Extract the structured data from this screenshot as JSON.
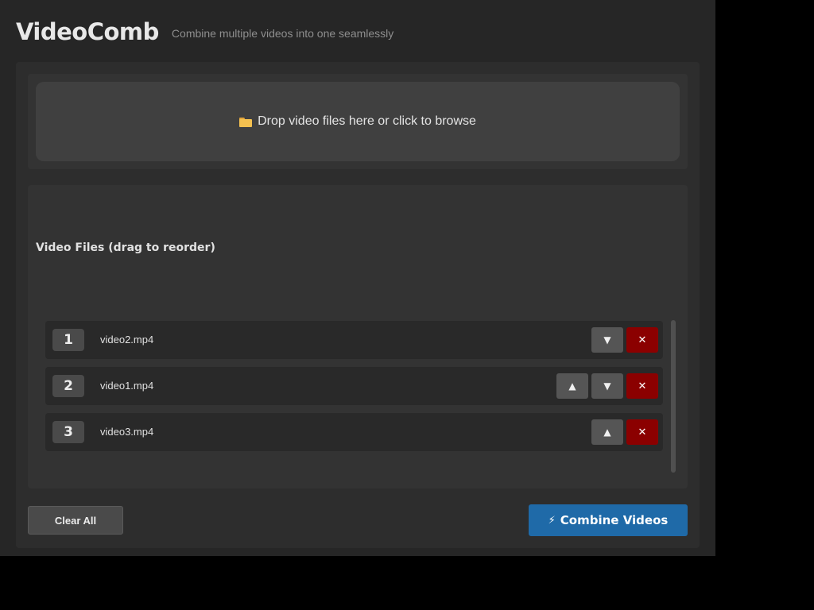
{
  "app": {
    "title": "VideoComb",
    "subtitle": "Combine multiple videos into one seamlessly"
  },
  "drop_zone": {
    "icon": "folder-icon",
    "label": "Drop video files here or click to browse"
  },
  "files": {
    "heading": "Video Files (drag to reorder)",
    "items": [
      {
        "index": "1",
        "name": "video2.mp4",
        "up_label": "▲",
        "down_label": "▼",
        "remove_label": "✕"
      },
      {
        "index": "2",
        "name": "video1.mp4",
        "up_label": "▲",
        "down_label": "▼",
        "remove_label": "✕"
      },
      {
        "index": "3",
        "name": "video3.mp4",
        "up_label": "▲",
        "down_label": "▼",
        "remove_label": "✕"
      }
    ]
  },
  "actions": {
    "clear_label": "Clear All",
    "combine_icon": "⚡",
    "combine_label": "Combine Videos"
  },
  "colors": {
    "background": "#262626",
    "accent": "#1f6aa8",
    "danger": "#8b0000"
  }
}
